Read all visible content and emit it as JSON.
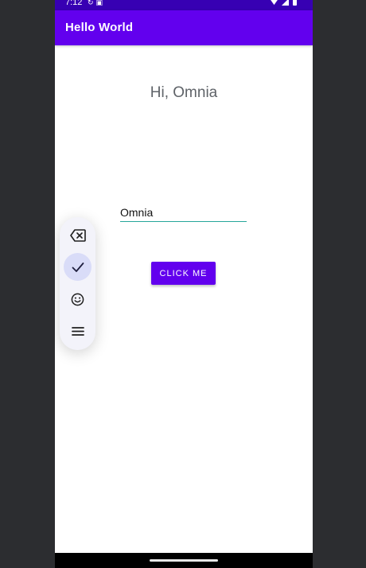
{
  "status_bar": {
    "time": "7:12",
    "left_icons": [
      "sync-icon",
      "notification-icon"
    ],
    "right_icons": [
      "wifi-icon",
      "signal-icon",
      "battery-icon"
    ],
    "color": "#3700b3"
  },
  "app_bar": {
    "title": "Hello World",
    "color": "#6200ee"
  },
  "main": {
    "greeting": "Hi, Omnia",
    "name_input": {
      "value": "Omnia",
      "underline_color": "#26a69a"
    },
    "button_label": "Click me"
  },
  "floating_toolbar": {
    "items": [
      {
        "icon": "backspace-icon",
        "active": false
      },
      {
        "icon": "check-icon",
        "active": true
      },
      {
        "icon": "emoji-icon",
        "active": false
      },
      {
        "icon": "menu-icon",
        "active": false
      }
    ]
  }
}
